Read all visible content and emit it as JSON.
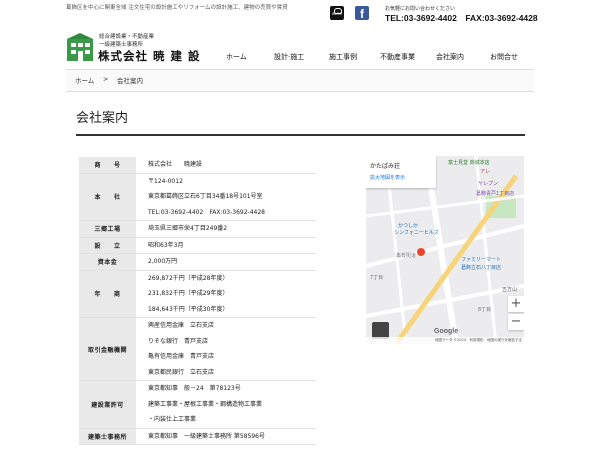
{
  "header": {
    "tagline": "葛飾区を中心に関東全域 注文住宅の設計施工やリフォームの設計施工、建物の売買や賃貸",
    "logo": {
      "sub1": "総合建設業・不動産業",
      "sub2": "一級建築士事務所",
      "name": "株式会社 暁 建 設"
    },
    "sns": {
      "blog_label": "BLOG",
      "facebook_label": "f"
    },
    "contact_note": "お気軽にお問い合わせください",
    "contact_line": "TEL:03-3692-4402　FAX:03-3692-4428"
  },
  "nav": [
    {
      "label": "ホーム"
    },
    {
      "label": "設計·施工"
    },
    {
      "label": "施工事例"
    },
    {
      "label": "不動産事業"
    },
    {
      "label": "会社案内"
    },
    {
      "label": "お問合せ"
    }
  ],
  "breadcrumb": {
    "home": "ホーム",
    "separator": ">",
    "current": "会社案内"
  },
  "page_title": "会社案内",
  "company_table": [
    {
      "label": "商　　号",
      "lines": [
        "株式会社　　暁建設"
      ]
    },
    {
      "label": "本　　社",
      "lines": [
        "〒124-0012",
        "東京都葛飾区立石6丁目34番18号101号室",
        "TEL:03-3692-4402　FAX:03-3692-4428"
      ]
    },
    {
      "label": "三郷工場",
      "lines": [
        "埼玉県三郷市栄4丁目249番2"
      ]
    },
    {
      "label": "設　　立",
      "lines": [
        "昭和63年3月"
      ]
    },
    {
      "label": "資本金",
      "lines": [
        "2,000万円"
      ]
    },
    {
      "label": "年　　商",
      "lines": [
        "269,872千円（平成28年度）",
        "231,832千円（平成29年度）",
        "184,643千円（平成30年度）"
      ]
    },
    {
      "label": "取引金融機関",
      "lines": [
        "興産信用金庫　立石支店",
        "りそな銀行　青戸支店",
        "亀有信用金庫　青戸支店",
        "東京都民銀行　立石支店"
      ]
    },
    {
      "label": "建設業許可",
      "lines": [
        "東京都知事　般－24　第78123号",
        "建築工事業・屋根工事業・鋼構造物工事業",
        "・内装仕上工事業"
      ]
    },
    {
      "label": "建築士事務所",
      "lines": [
        "東京都知事　一級建築士事務所 第58596号"
      ]
    }
  ],
  "map": {
    "place_name": "かたぱみ荘",
    "larger_map_link": "拡大地図を表示",
    "zoom_in": "+",
    "zoom_out": "−",
    "google": "Google",
    "footer": "地図データ ©2024　利用規約　地図の誤りを報告する",
    "labels": [
      "富士見堂 商城本店",
      "アレ",
      "ヤレプン",
      "葛飾青戸1丁目店",
      "かつしか",
      "シンフォニーヒルズ",
      "ファミリーマート",
      "葛飾立石八丁目店",
      "五方山",
      "亀有街道",
      "7丁目",
      "8丁目"
    ],
    "colors": {
      "land": "#ececee",
      "road": "#ffffff",
      "major_road": "#f7d37a",
      "park": "#c8e6c0",
      "pin": "#e8472a"
    }
  }
}
